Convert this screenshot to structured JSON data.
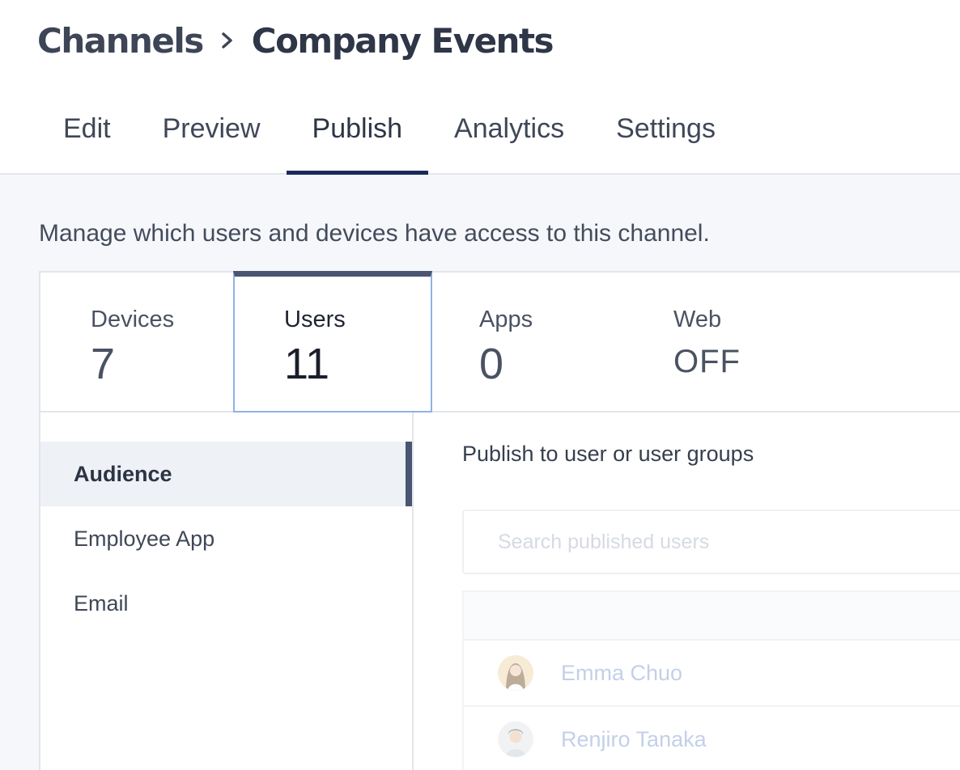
{
  "breadcrumb": {
    "parent": "Channels",
    "current": "Company Events"
  },
  "tabs": [
    {
      "label": "Edit",
      "active": false
    },
    {
      "label": "Preview",
      "active": false
    },
    {
      "label": "Publish",
      "active": true
    },
    {
      "label": "Analytics",
      "active": false
    },
    {
      "label": "Settings",
      "active": false
    }
  ],
  "intro_text": "Manage which users and devices have access to this channel.",
  "stats": [
    {
      "label": "Devices",
      "value": "7"
    },
    {
      "label": "Users",
      "value": "11",
      "selected": true
    },
    {
      "label": "Apps",
      "value": "0"
    },
    {
      "label": "Web",
      "value": "OFF"
    }
  ],
  "subnav": [
    {
      "label": "Audience",
      "active": true
    },
    {
      "label": "Employee App",
      "active": false
    },
    {
      "label": "Email",
      "active": false
    }
  ],
  "content": {
    "title": "Publish to user or user groups",
    "search_placeholder": "Search published users",
    "users": [
      {
        "name": "Emma Chuo",
        "avatar": "woman-avatar"
      },
      {
        "name": "Renjiro Tanaka",
        "avatar": "man-avatar"
      }
    ]
  },
  "colors": {
    "tab_underline": "#1b2a5c",
    "selected_card_border": "#8fb2e8",
    "selected_card_top": "#4a5571",
    "user_name_faded": "#c3d0ea"
  }
}
